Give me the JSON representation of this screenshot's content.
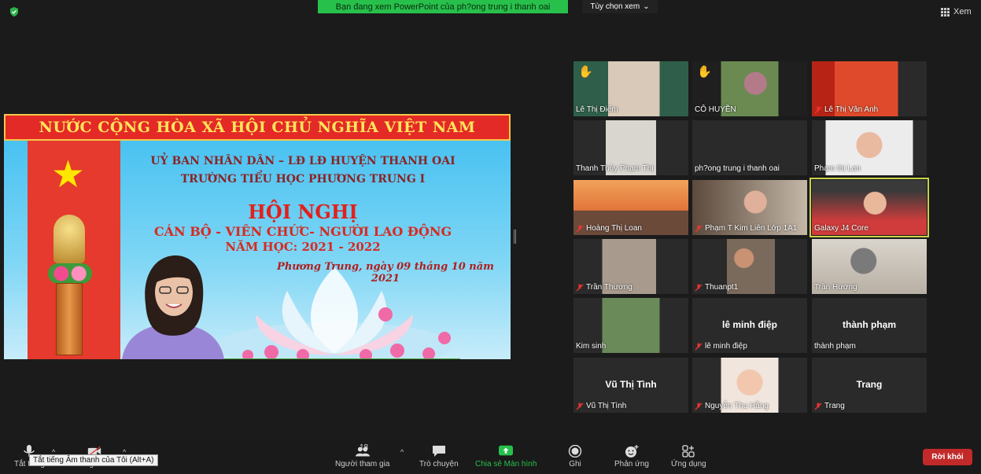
{
  "top": {
    "share_banner": "Bạn đang xem PowerPoint của ph?ong trung i thanh oai",
    "view_options": "Tùy chọn xem",
    "view_options_icon": "chevron-down-icon",
    "view_label": "Xem"
  },
  "slide": {
    "title": "NƯỚC CỘNG HÒA XÃ HỘI CHỦ NGHĨA VIỆT NAM",
    "line1": "UỶ BAN NHÂN DÂN – LĐ LĐ HUYỆN THANH OAI",
    "line2": "TRƯỜNG TIỂU HỌC PHƯƠNG TRUNG I",
    "heading": "HỘI NGHỊ",
    "line3": "CÁN BỘ - VIÊN CHỨC- NGƯỜI LAO ĐỘNG",
    "line4": "NĂM HỌC: 2021 - 2022",
    "place_date": "Phương Trung, ngày  09 tháng 10 năm 2021"
  },
  "participants": [
    {
      "name": "Lê Thị Điểm",
      "muted": false,
      "hand": true,
      "video": true,
      "center_name": ""
    },
    {
      "name": "CÔ HUYỀN",
      "muted": false,
      "hand": true,
      "video": true,
      "center_name": ""
    },
    {
      "name": "Lê Thị Vân Anh",
      "muted": true,
      "hand": false,
      "video": true,
      "center_name": ""
    },
    {
      "name": "Thanh Thủy Phạm Thị",
      "muted": false,
      "hand": false,
      "video": true,
      "center_name": ""
    },
    {
      "name": "ph?ong trung i thanh oai",
      "muted": false,
      "hand": false,
      "video": false,
      "center_name": ""
    },
    {
      "name": "Phạm thị Lan",
      "muted": false,
      "hand": false,
      "video": true,
      "center_name": ""
    },
    {
      "name": "Hoàng Thị Loan",
      "muted": true,
      "hand": false,
      "video": true,
      "center_name": ""
    },
    {
      "name": "Phạm T Kim Liên Lớp 1A1",
      "muted": true,
      "hand": false,
      "video": true,
      "center_name": ""
    },
    {
      "name": "Galaxy J4 Core",
      "muted": false,
      "hand": false,
      "video": true,
      "center_name": ""
    },
    {
      "name": "Trần Thương",
      "muted": true,
      "hand": false,
      "video": true,
      "center_name": ""
    },
    {
      "name": "Thuanpt1",
      "muted": true,
      "hand": false,
      "video": true,
      "center_name": ""
    },
    {
      "name": "Trần Hương",
      "muted": false,
      "hand": false,
      "video": true,
      "center_name": ""
    },
    {
      "name": "Kim sinh",
      "muted": false,
      "hand": false,
      "video": true,
      "center_name": ""
    },
    {
      "name": "lê minh điệp",
      "muted": true,
      "hand": false,
      "video": false,
      "center_name": "lê minh điệp"
    },
    {
      "name": "thành phạm",
      "muted": false,
      "hand": false,
      "video": false,
      "center_name": "thành phạm"
    },
    {
      "name": "Vũ Thị Tình",
      "muted": true,
      "hand": false,
      "video": false,
      "center_name": "Vũ Thị Tình"
    },
    {
      "name": "Nguyễn Thu Hằng",
      "muted": true,
      "hand": false,
      "video": true,
      "center_name": ""
    },
    {
      "name": "Trang",
      "muted": true,
      "hand": false,
      "video": false,
      "center_name": "Trang"
    }
  ],
  "toolbar": {
    "mute_label": "Tắt tiếng",
    "video_label": "Dừng video",
    "participants_label": "Người tham gia",
    "participants_count": "18",
    "chat_label": "Trò chuyện",
    "share_label": "Chia sẻ Màn hình",
    "record_label": "Ghi",
    "reactions_label": "Phản ứng",
    "apps_label": "Ứng dụng",
    "leave_label": "Rời khỏi",
    "tooltip": "Tắt tiếng Âm thanh của Tôi (Alt+A)",
    "share_color": "#27c04b",
    "leave_color": "#c22a2a"
  }
}
